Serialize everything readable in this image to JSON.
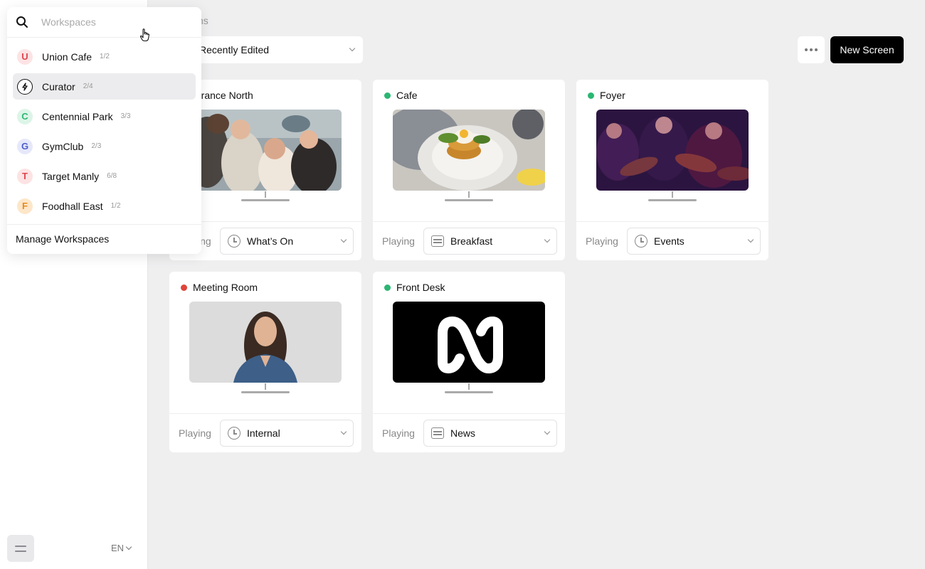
{
  "sidebar": {
    "language": "EN"
  },
  "workspace_switcher": {
    "search_placeholder": "Workspaces",
    "items": [
      {
        "initial": "U",
        "name": "Union Cafe",
        "count": "1/2",
        "bg": "#fde3e4",
        "fg": "#e0464f",
        "active": false
      },
      {
        "initial": "",
        "name": "Curator",
        "count": "2/4",
        "bg": "#ffffff",
        "fg": "#111111",
        "active": true
      },
      {
        "initial": "C",
        "name": "Centennial Park",
        "count": "3/3",
        "bg": "#dcf5e8",
        "fg": "#2bb673",
        "active": false
      },
      {
        "initial": "G",
        "name": "GymClub",
        "count": "2/3",
        "bg": "#e6e8fa",
        "fg": "#4b5bcf",
        "active": false
      },
      {
        "initial": "T",
        "name": "Target Manly",
        "count": "6/8",
        "bg": "#fde3e4",
        "fg": "#e0464f",
        "active": false
      },
      {
        "initial": "F",
        "name": "Foodhall East",
        "count": "1/2",
        "bg": "#fde6c9",
        "fg": "#e58a1f",
        "active": false
      }
    ],
    "manage_label": "Manage Workspaces"
  },
  "header": {
    "title_fragment": "ns",
    "sort_label": "Recently Edited",
    "new_screen_label": "New Screen"
  },
  "screens": [
    {
      "name": "Entrance North",
      "visible_name": "ntrance North",
      "status": "online",
      "playing_label": "Playing",
      "visible_playing_label": "ing",
      "playlist": "What’s On",
      "playlist_icon": "clock-icon"
    },
    {
      "name": "Cafe",
      "status": "online",
      "playing_label": "Playing",
      "playlist": "Breakfast",
      "playlist_icon": "list-icon"
    },
    {
      "name": "Foyer",
      "status": "online",
      "playing_label": "Playing",
      "playlist": "Events",
      "playlist_icon": "clock-icon"
    },
    {
      "name": "Meeting Room",
      "status": "offline",
      "playing_label": "Playing",
      "playlist": "Internal",
      "playlist_icon": "clock-icon"
    },
    {
      "name": "Front Desk",
      "status": "online",
      "playing_label": "Playing",
      "playlist": "News",
      "playlist_icon": "list-icon"
    }
  ],
  "colors": {
    "online": "#2bb673",
    "offline": "#e0443a",
    "primary_button": "#000000"
  }
}
